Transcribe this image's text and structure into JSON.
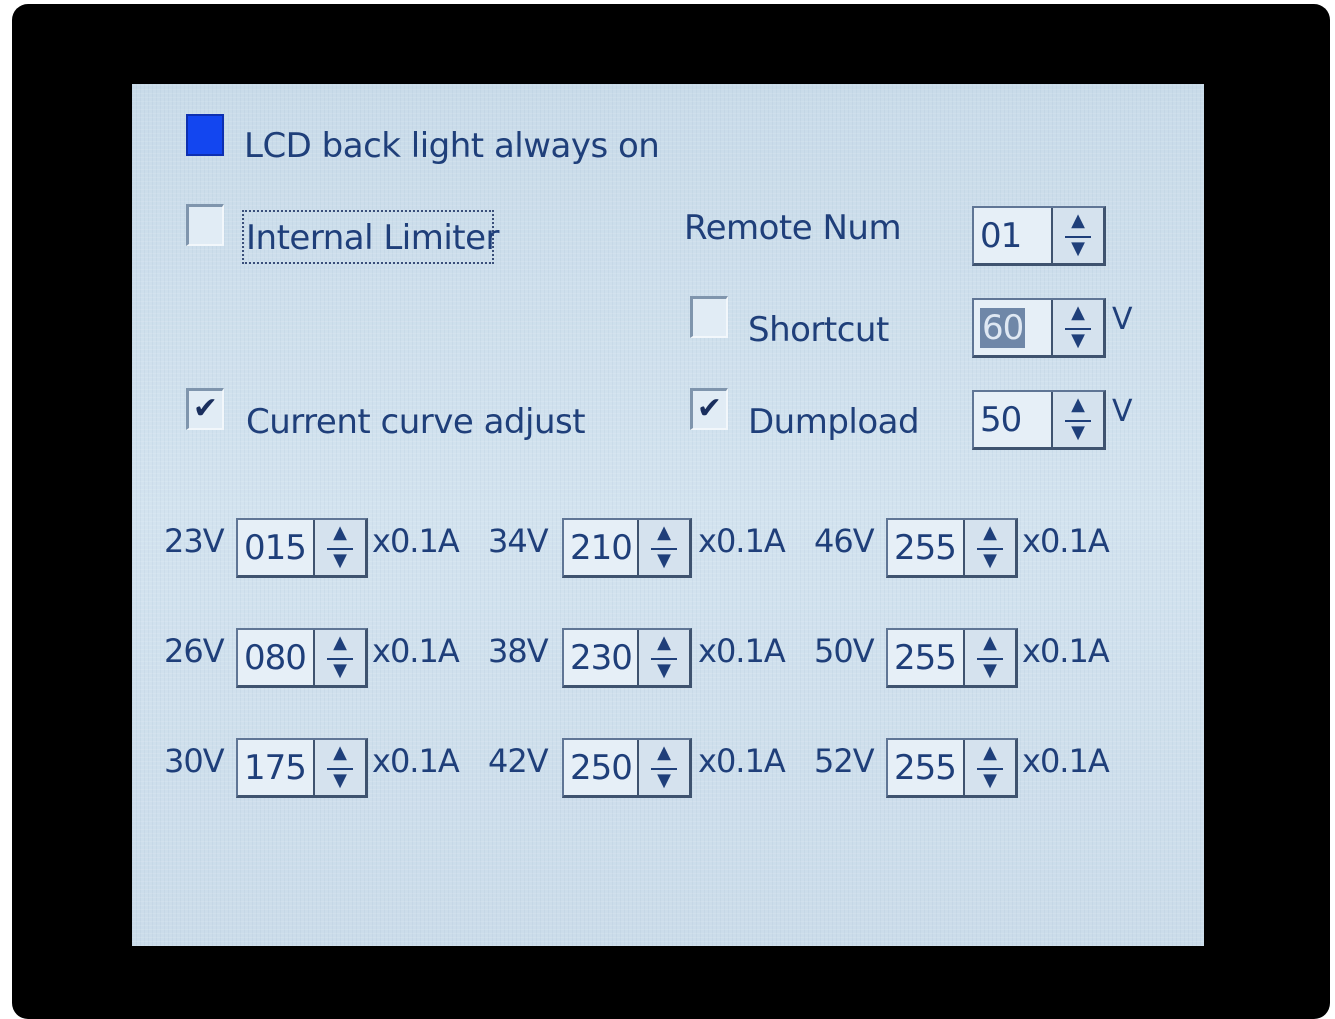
{
  "settings": {
    "backlight_label": "LCD back light always on",
    "backlight_checked": true,
    "internal_limiter_label": "Internal Limiter",
    "internal_limiter_checked": false,
    "remote_num_label": "Remote Num",
    "remote_num_value": "01",
    "shortcut_label": "Shortcut",
    "shortcut_checked": false,
    "shortcut_value": "60",
    "shortcut_unit": "V",
    "current_curve_label": "Current curve adjust",
    "current_curve_checked": true,
    "dumpload_label": "Dumpload",
    "dumpload_checked": true,
    "dumpload_value": "50",
    "dumpload_unit": "V",
    "check_glyph": "✔"
  },
  "curve": {
    "unit": "x0.1A",
    "rows": [
      [
        {
          "voltage": "23V",
          "value": "015"
        },
        {
          "voltage": "34V",
          "value": "210"
        },
        {
          "voltage": "46V",
          "value": "255"
        }
      ],
      [
        {
          "voltage": "26V",
          "value": "080"
        },
        {
          "voltage": "38V",
          "value": "230"
        },
        {
          "voltage": "50V",
          "value": "255"
        }
      ],
      [
        {
          "voltage": "30V",
          "value": "175"
        },
        {
          "voltage": "42V",
          "value": "250"
        },
        {
          "voltage": "52V",
          "value": "255"
        }
      ]
    ]
  },
  "icons": {
    "spin_up": "▲",
    "spin_down": "▼"
  },
  "colors": {
    "screen": "#cfe0ed",
    "text": "#1f3f7a",
    "checked_fill": "#1346f0"
  }
}
